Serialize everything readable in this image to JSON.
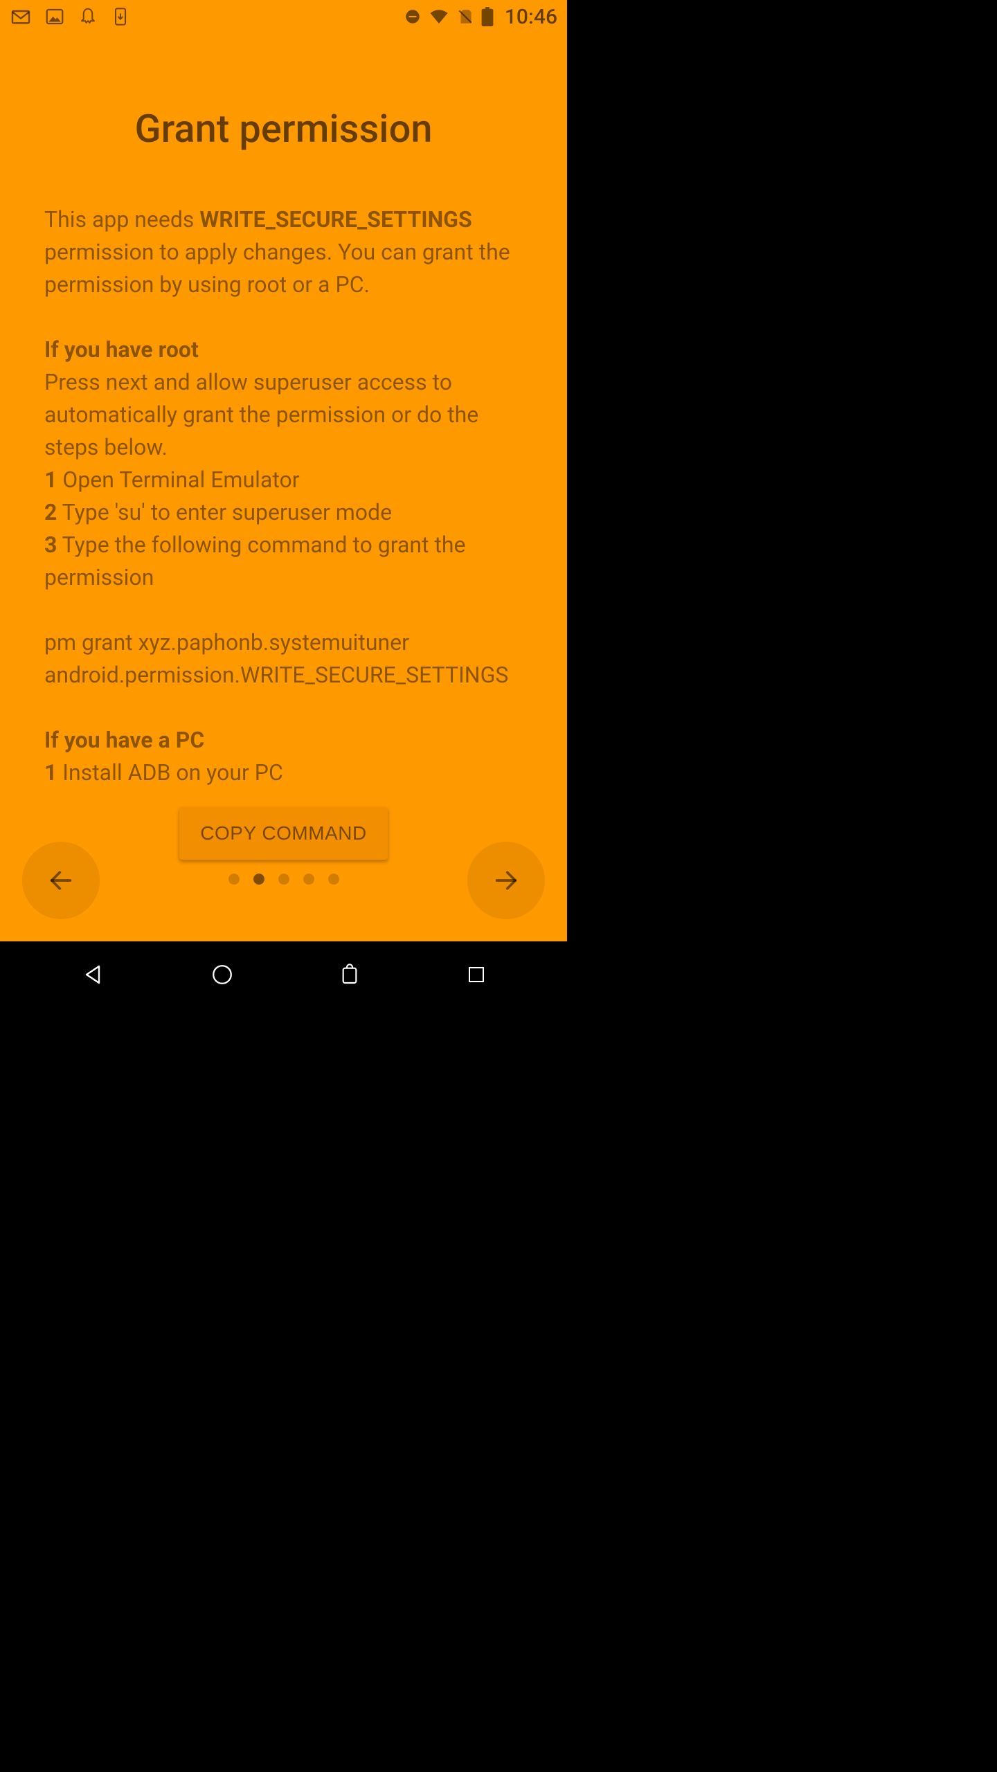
{
  "status": {
    "time": "10:46"
  },
  "page": {
    "title": "Grant permission",
    "intro_prefix": "This app needs ",
    "intro_perm": "WRITE_SECURE_SETTINGS",
    "intro_suffix": " permission to apply changes. You can grant the permission by using root or a PC.",
    "root_heading": "If you have root",
    "root_desc": "Press next and allow superuser access to automatically grant the permission or do the steps below.",
    "root_step1_num": "1",
    "root_step1": " Open Terminal Emulator",
    "root_step2_num": "2",
    "root_step2": " Type 'su' to enter superuser mode",
    "root_step3_num": "3",
    "root_step3": " Type the following command to grant the permission",
    "command": "pm grant xyz.paphonb.systemuituner android.permission.WRITE_SECURE_SETTINGS",
    "pc_heading": "If you have a PC",
    "pc_step1_num": "1",
    "pc_step1": " Install ADB on your PC",
    "copy_button": "COPY COMMAND"
  },
  "pager": {
    "count": 5,
    "active": 1
  }
}
